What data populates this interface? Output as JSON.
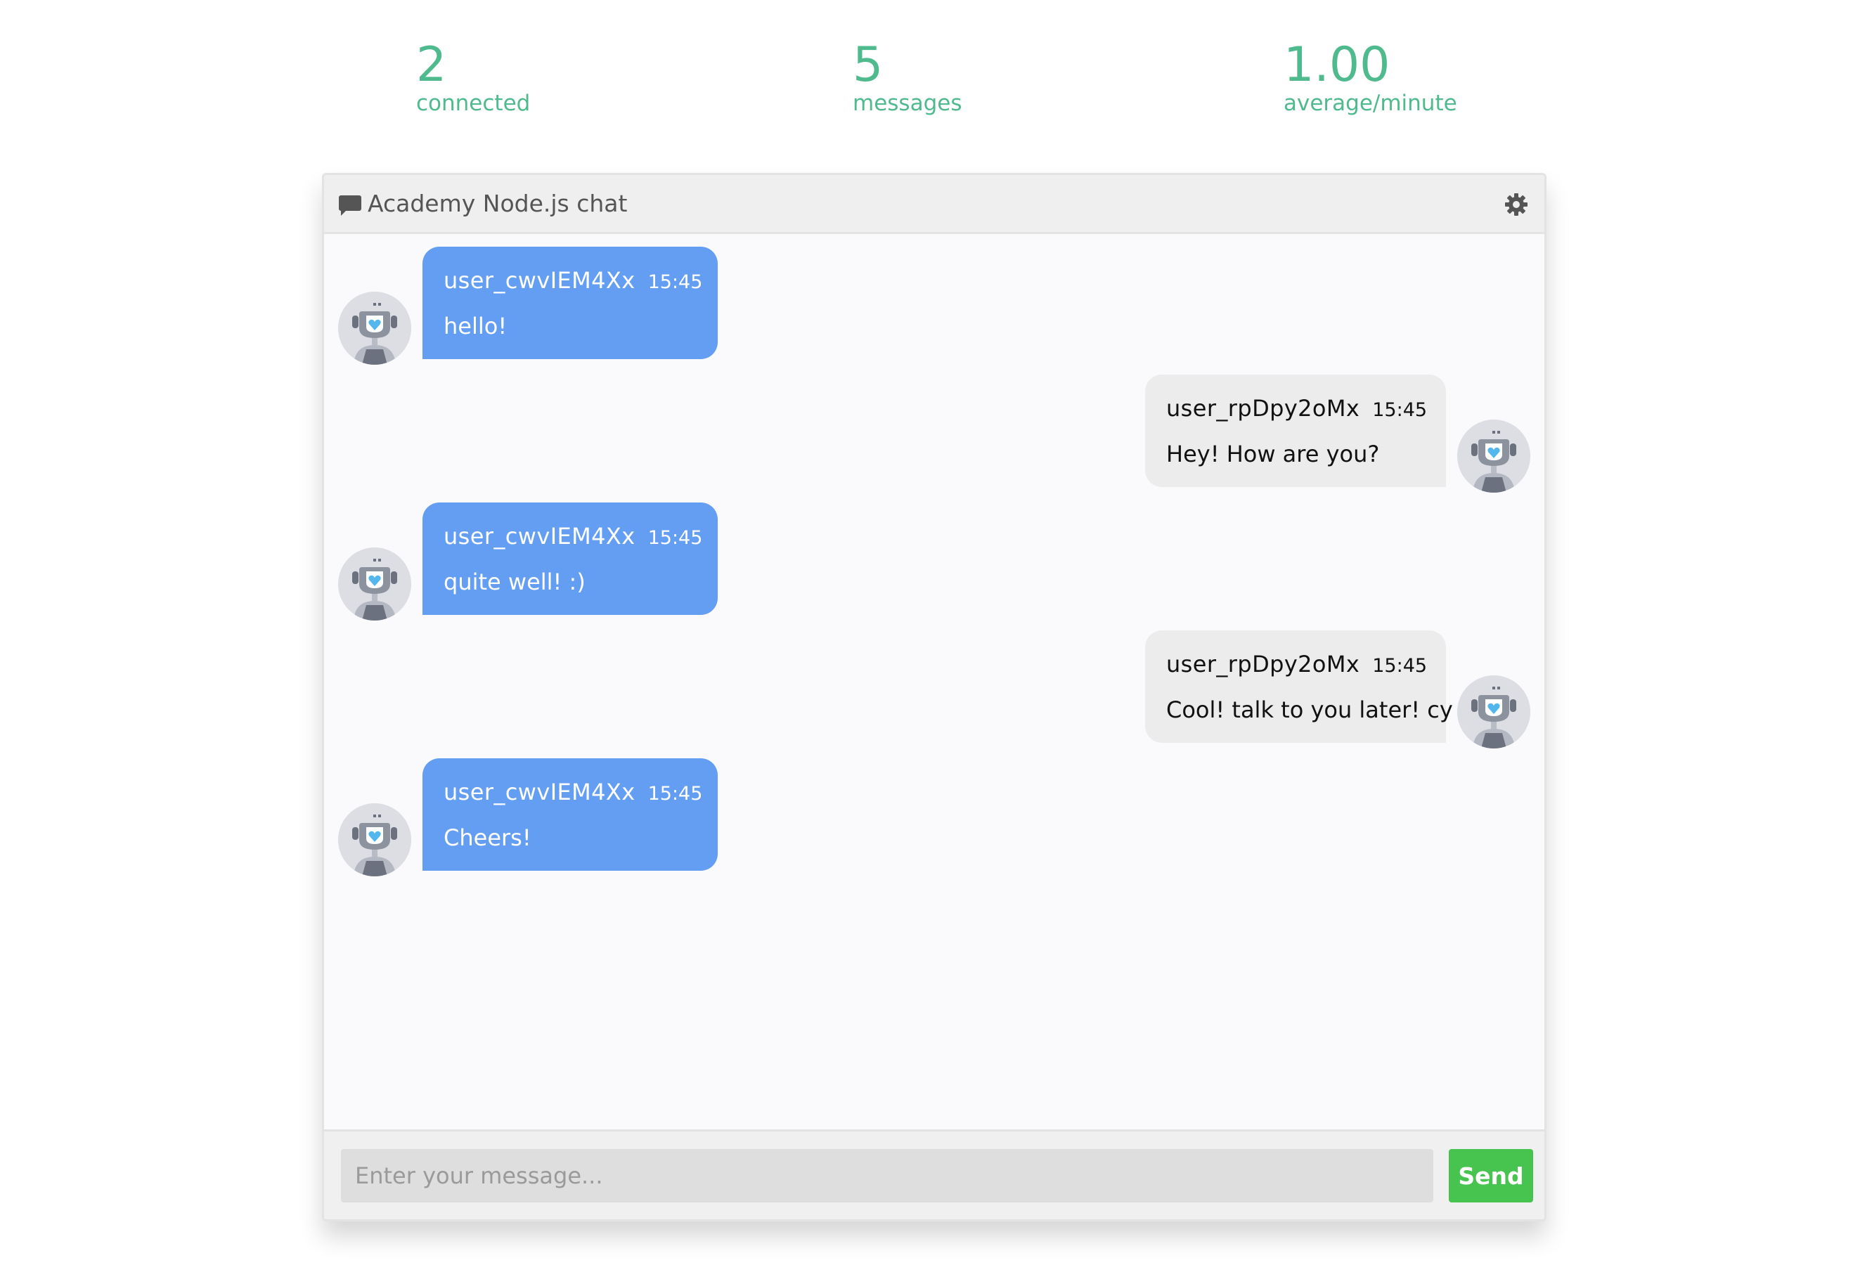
{
  "stats": {
    "connected": {
      "value": "2",
      "label": "connected"
    },
    "messages": {
      "value": "5",
      "label": "messages"
    },
    "average": {
      "value": "1.00",
      "label": "average/minute"
    }
  },
  "chat": {
    "title": "Academy Node.js chat",
    "icons": {
      "header": "comment-icon",
      "settings": "gear-icon",
      "avatar": "robot-avatar"
    },
    "messages": [
      {
        "user": "user_cwvIEM4Xx",
        "time": "15:45",
        "text": "hello!",
        "side": "incoming"
      },
      {
        "user": "user_rpDpy2oMx",
        "time": "15:45",
        "text": "Hey! How are you?",
        "side": "outgoing"
      },
      {
        "user": "user_cwvIEM4Xx",
        "time": "15:45",
        "text": "quite well! :)",
        "side": "incoming"
      },
      {
        "user": "user_rpDpy2oMx",
        "time": "15:45",
        "text": "Cool! talk to you later! cy",
        "side": "outgoing"
      },
      {
        "user": "user_cwvIEM4Xx",
        "time": "15:45",
        "text": "Cheers!",
        "side": "incoming"
      }
    ]
  },
  "composer": {
    "placeholder": "Enter your message...",
    "value": "",
    "send_label": "Send"
  },
  "colors": {
    "stats": "#4fba8e",
    "incoming_bubble": "#639ef3",
    "outgoing_bubble": "#ececec",
    "send_button": "#47c34f"
  }
}
